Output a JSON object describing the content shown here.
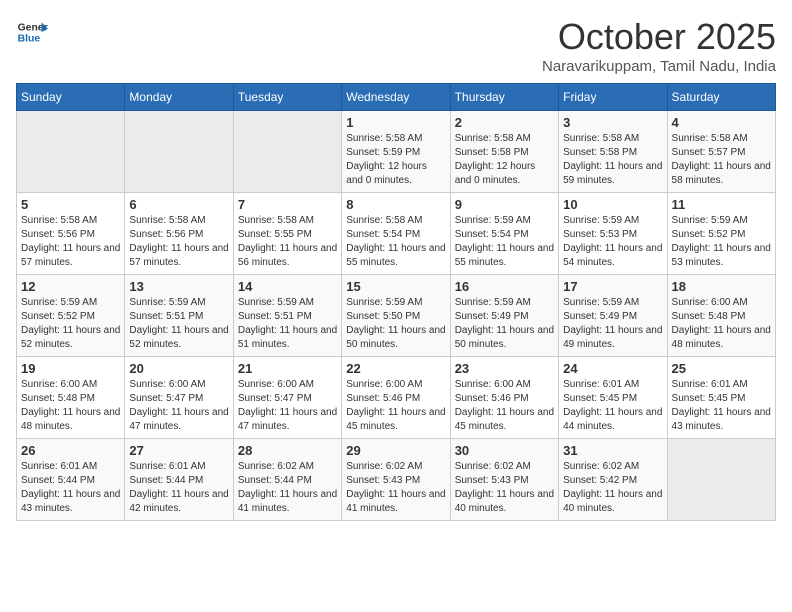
{
  "header": {
    "logo_general": "General",
    "logo_blue": "Blue",
    "month_title": "October 2025",
    "subtitle": "Naravarikuppam, Tamil Nadu, India"
  },
  "days_of_week": [
    "Sunday",
    "Monday",
    "Tuesday",
    "Wednesday",
    "Thursday",
    "Friday",
    "Saturday"
  ],
  "weeks": [
    [
      {
        "num": "",
        "sunrise": "",
        "sunset": "",
        "daylight": "",
        "empty": true
      },
      {
        "num": "",
        "sunrise": "",
        "sunset": "",
        "daylight": "",
        "empty": true
      },
      {
        "num": "",
        "sunrise": "",
        "sunset": "",
        "daylight": "",
        "empty": true
      },
      {
        "num": "1",
        "sunrise": "Sunrise: 5:58 AM",
        "sunset": "Sunset: 5:59 PM",
        "daylight": "Daylight: 12 hours and 0 minutes."
      },
      {
        "num": "2",
        "sunrise": "Sunrise: 5:58 AM",
        "sunset": "Sunset: 5:58 PM",
        "daylight": "Daylight: 12 hours and 0 minutes."
      },
      {
        "num": "3",
        "sunrise": "Sunrise: 5:58 AM",
        "sunset": "Sunset: 5:58 PM",
        "daylight": "Daylight: 11 hours and 59 minutes."
      },
      {
        "num": "4",
        "sunrise": "Sunrise: 5:58 AM",
        "sunset": "Sunset: 5:57 PM",
        "daylight": "Daylight: 11 hours and 58 minutes."
      }
    ],
    [
      {
        "num": "5",
        "sunrise": "Sunrise: 5:58 AM",
        "sunset": "Sunset: 5:56 PM",
        "daylight": "Daylight: 11 hours and 57 minutes."
      },
      {
        "num": "6",
        "sunrise": "Sunrise: 5:58 AM",
        "sunset": "Sunset: 5:56 PM",
        "daylight": "Daylight: 11 hours and 57 minutes."
      },
      {
        "num": "7",
        "sunrise": "Sunrise: 5:58 AM",
        "sunset": "Sunset: 5:55 PM",
        "daylight": "Daylight: 11 hours and 56 minutes."
      },
      {
        "num": "8",
        "sunrise": "Sunrise: 5:58 AM",
        "sunset": "Sunset: 5:54 PM",
        "daylight": "Daylight: 11 hours and 55 minutes."
      },
      {
        "num": "9",
        "sunrise": "Sunrise: 5:59 AM",
        "sunset": "Sunset: 5:54 PM",
        "daylight": "Daylight: 11 hours and 55 minutes."
      },
      {
        "num": "10",
        "sunrise": "Sunrise: 5:59 AM",
        "sunset": "Sunset: 5:53 PM",
        "daylight": "Daylight: 11 hours and 54 minutes."
      },
      {
        "num": "11",
        "sunrise": "Sunrise: 5:59 AM",
        "sunset": "Sunset: 5:52 PM",
        "daylight": "Daylight: 11 hours and 53 minutes."
      }
    ],
    [
      {
        "num": "12",
        "sunrise": "Sunrise: 5:59 AM",
        "sunset": "Sunset: 5:52 PM",
        "daylight": "Daylight: 11 hours and 52 minutes."
      },
      {
        "num": "13",
        "sunrise": "Sunrise: 5:59 AM",
        "sunset": "Sunset: 5:51 PM",
        "daylight": "Daylight: 11 hours and 52 minutes."
      },
      {
        "num": "14",
        "sunrise": "Sunrise: 5:59 AM",
        "sunset": "Sunset: 5:51 PM",
        "daylight": "Daylight: 11 hours and 51 minutes."
      },
      {
        "num": "15",
        "sunrise": "Sunrise: 5:59 AM",
        "sunset": "Sunset: 5:50 PM",
        "daylight": "Daylight: 11 hours and 50 minutes."
      },
      {
        "num": "16",
        "sunrise": "Sunrise: 5:59 AM",
        "sunset": "Sunset: 5:49 PM",
        "daylight": "Daylight: 11 hours and 50 minutes."
      },
      {
        "num": "17",
        "sunrise": "Sunrise: 5:59 AM",
        "sunset": "Sunset: 5:49 PM",
        "daylight": "Daylight: 11 hours and 49 minutes."
      },
      {
        "num": "18",
        "sunrise": "Sunrise: 6:00 AM",
        "sunset": "Sunset: 5:48 PM",
        "daylight": "Daylight: 11 hours and 48 minutes."
      }
    ],
    [
      {
        "num": "19",
        "sunrise": "Sunrise: 6:00 AM",
        "sunset": "Sunset: 5:48 PM",
        "daylight": "Daylight: 11 hours and 48 minutes."
      },
      {
        "num": "20",
        "sunrise": "Sunrise: 6:00 AM",
        "sunset": "Sunset: 5:47 PM",
        "daylight": "Daylight: 11 hours and 47 minutes."
      },
      {
        "num": "21",
        "sunrise": "Sunrise: 6:00 AM",
        "sunset": "Sunset: 5:47 PM",
        "daylight": "Daylight: 11 hours and 47 minutes."
      },
      {
        "num": "22",
        "sunrise": "Sunrise: 6:00 AM",
        "sunset": "Sunset: 5:46 PM",
        "daylight": "Daylight: 11 hours and 45 minutes."
      },
      {
        "num": "23",
        "sunrise": "Sunrise: 6:00 AM",
        "sunset": "Sunset: 5:46 PM",
        "daylight": "Daylight: 11 hours and 45 minutes."
      },
      {
        "num": "24",
        "sunrise": "Sunrise: 6:01 AM",
        "sunset": "Sunset: 5:45 PM",
        "daylight": "Daylight: 11 hours and 44 minutes."
      },
      {
        "num": "25",
        "sunrise": "Sunrise: 6:01 AM",
        "sunset": "Sunset: 5:45 PM",
        "daylight": "Daylight: 11 hours and 43 minutes."
      }
    ],
    [
      {
        "num": "26",
        "sunrise": "Sunrise: 6:01 AM",
        "sunset": "Sunset: 5:44 PM",
        "daylight": "Daylight: 11 hours and 43 minutes."
      },
      {
        "num": "27",
        "sunrise": "Sunrise: 6:01 AM",
        "sunset": "Sunset: 5:44 PM",
        "daylight": "Daylight: 11 hours and 42 minutes."
      },
      {
        "num": "28",
        "sunrise": "Sunrise: 6:02 AM",
        "sunset": "Sunset: 5:44 PM",
        "daylight": "Daylight: 11 hours and 41 minutes."
      },
      {
        "num": "29",
        "sunrise": "Sunrise: 6:02 AM",
        "sunset": "Sunset: 5:43 PM",
        "daylight": "Daylight: 11 hours and 41 minutes."
      },
      {
        "num": "30",
        "sunrise": "Sunrise: 6:02 AM",
        "sunset": "Sunset: 5:43 PM",
        "daylight": "Daylight: 11 hours and 40 minutes."
      },
      {
        "num": "31",
        "sunrise": "Sunrise: 6:02 AM",
        "sunset": "Sunset: 5:42 PM",
        "daylight": "Daylight: 11 hours and 40 minutes."
      },
      {
        "num": "",
        "sunrise": "",
        "sunset": "",
        "daylight": "",
        "empty": true
      }
    ]
  ]
}
